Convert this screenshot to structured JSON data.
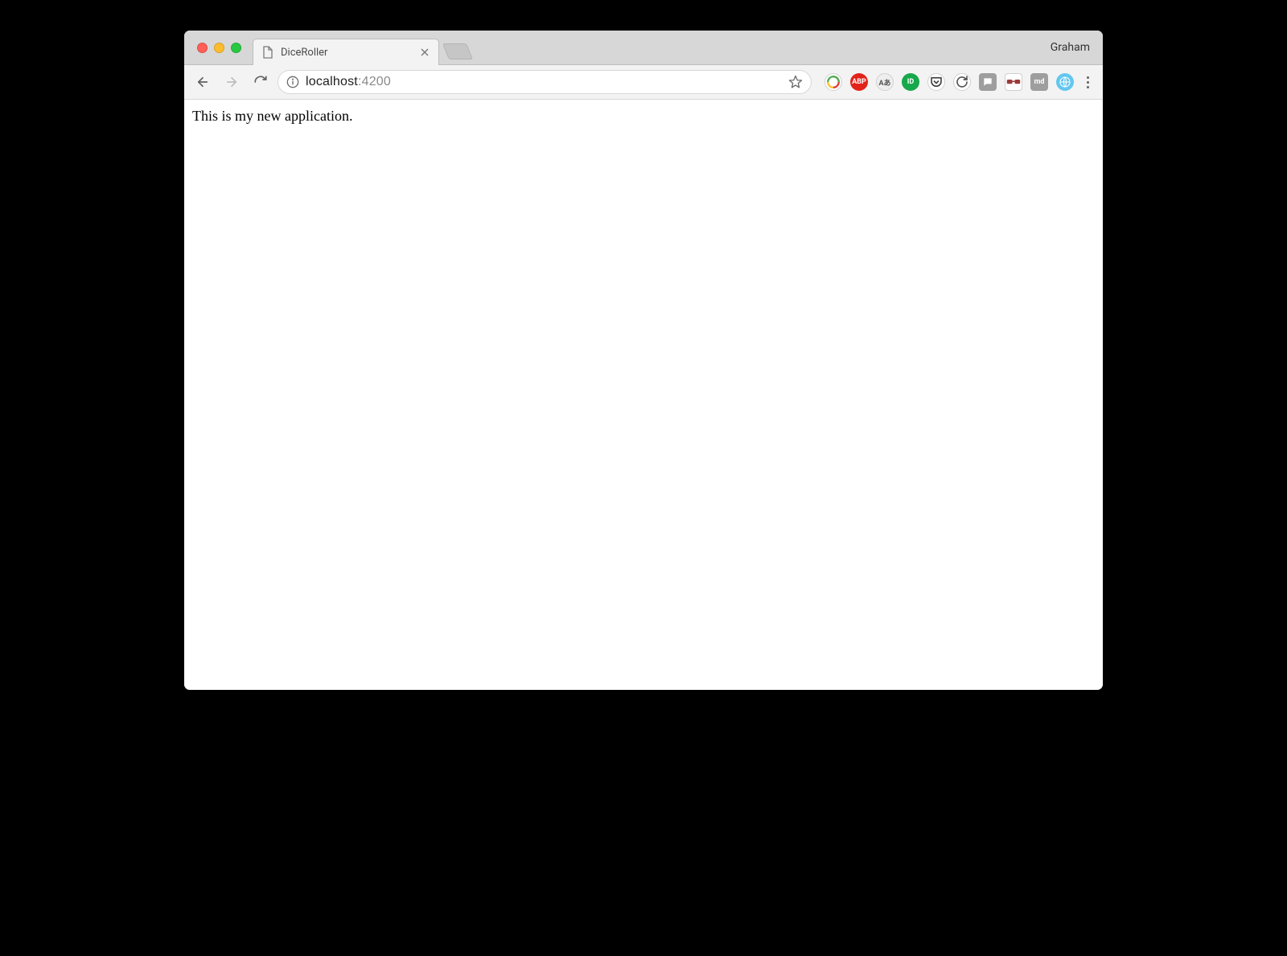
{
  "window": {
    "profile_name": "Graham"
  },
  "tab": {
    "title": "DiceRoller"
  },
  "address": {
    "host": "localhost",
    "port": ":4200"
  },
  "extensions": [
    {
      "id": "ext-swirl",
      "bg": "#ffffff",
      "label": "",
      "shape": "circle",
      "swirl": true,
      "textColor": "#333"
    },
    {
      "id": "ext-abp",
      "bg": "#e2231a",
      "label": "ABP",
      "shape": "circle",
      "textColor": "#fff"
    },
    {
      "id": "ext-a",
      "bg": "#eeeeee",
      "label": "Aあ",
      "shape": "circle",
      "textColor": "#555"
    },
    {
      "id": "ext-id",
      "bg": "#17a84b",
      "label": "ID",
      "shape": "circle",
      "textColor": "#fff"
    },
    {
      "id": "ext-pocket",
      "bg": "#ffffff",
      "label": "",
      "shape": "circle",
      "pocket": true,
      "textColor": "#444"
    },
    {
      "id": "ext-refresh",
      "bg": "#ffffff",
      "label": "",
      "shape": "circle",
      "refresh": true,
      "textColor": "#555"
    },
    {
      "id": "ext-chat",
      "bg": "#9e9e9e",
      "label": "",
      "shape": "square",
      "chat": true,
      "textColor": "#fff"
    },
    {
      "id": "ext-glasses",
      "bg": "#ffffff",
      "label": "",
      "shape": "square",
      "glasses": true,
      "textColor": "#a33"
    },
    {
      "id": "ext-md",
      "bg": "#9e9e9e",
      "label": "md",
      "shape": "square",
      "textColor": "#fff"
    },
    {
      "id": "ext-globe",
      "bg": "#63c7ef",
      "label": "",
      "shape": "circle",
      "globe": true,
      "textColor": "#fff"
    }
  ],
  "page": {
    "body_text": "This is my new application."
  }
}
